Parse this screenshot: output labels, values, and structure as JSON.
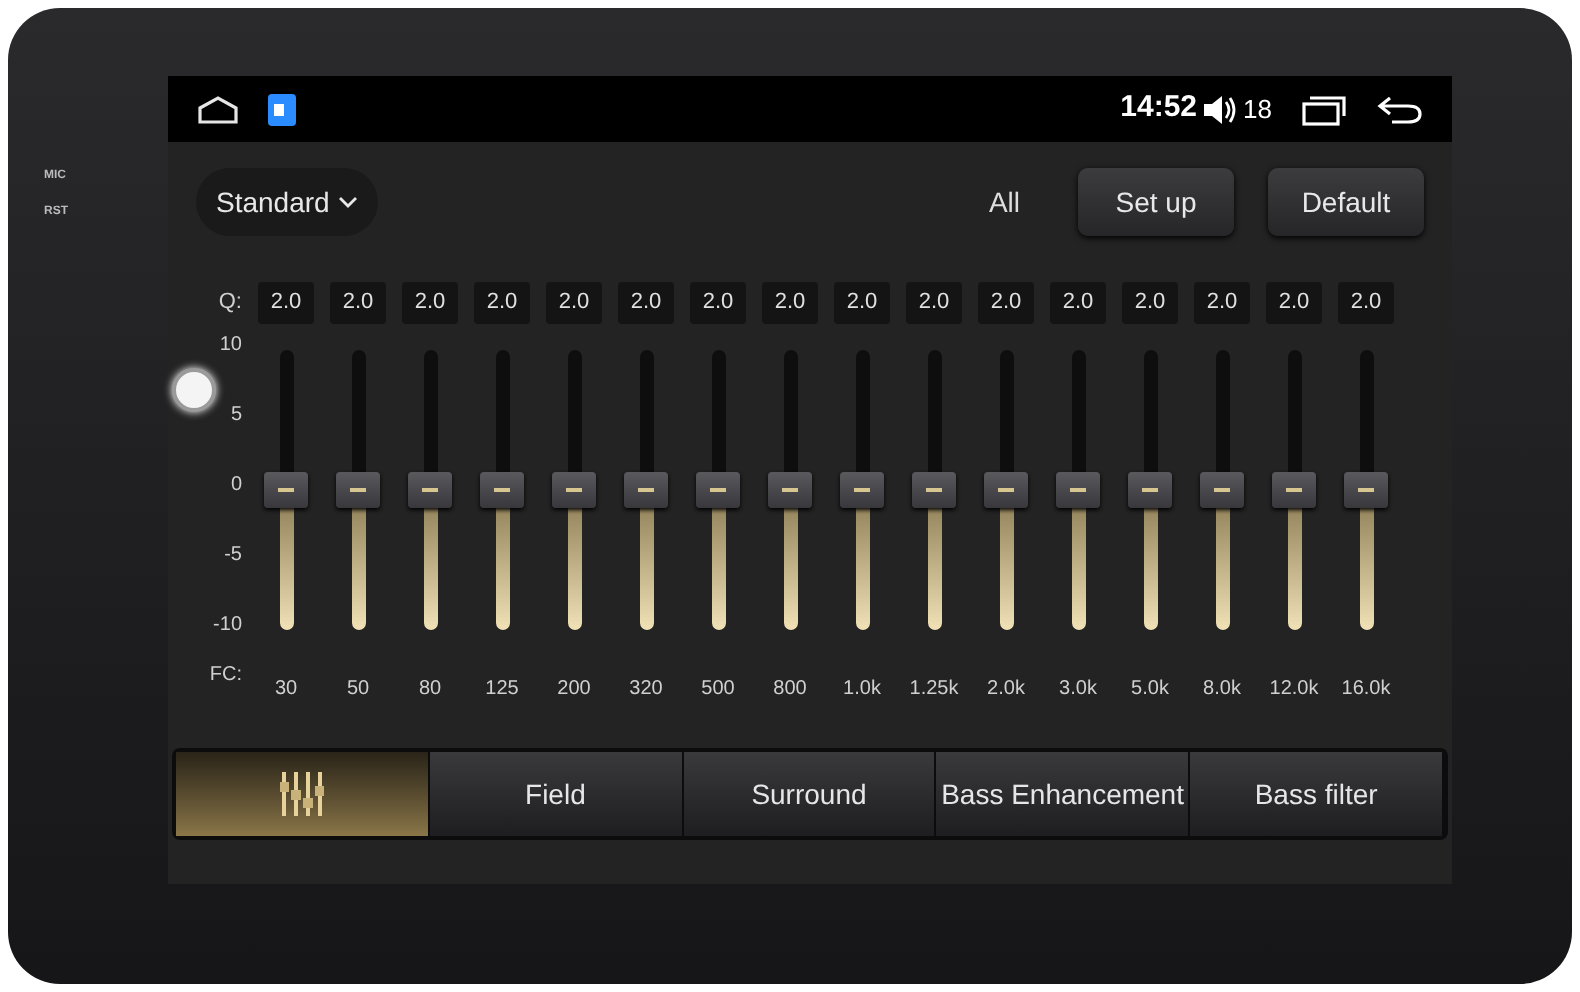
{
  "bezel": {
    "labels": [
      "MIC",
      "RST"
    ]
  },
  "status_bar": {
    "time": "14:52",
    "volume": "18"
  },
  "toolbar": {
    "preset": "Standard",
    "all_label": "All",
    "buttons": [
      "Set up",
      "Default"
    ]
  },
  "equalizer": {
    "q_label": "Q:",
    "fc_label": "FC:",
    "scale": [
      "10",
      "5",
      "0",
      "-5",
      "-10"
    ],
    "bands": [
      {
        "q": "2.0",
        "fc": "30",
        "level": 0.5
      },
      {
        "q": "2.0",
        "fc": "50",
        "level": 0.5
      },
      {
        "q": "2.0",
        "fc": "80",
        "level": 0.5
      },
      {
        "q": "2.0",
        "fc": "125",
        "level": 0.5
      },
      {
        "q": "2.0",
        "fc": "200",
        "level": 0.5
      },
      {
        "q": "2.0",
        "fc": "320",
        "level": 0.5
      },
      {
        "q": "2.0",
        "fc": "500",
        "level": 0.5
      },
      {
        "q": "2.0",
        "fc": "800",
        "level": 0.5
      },
      {
        "q": "2.0",
        "fc": "1.0k",
        "level": 0.5
      },
      {
        "q": "2.0",
        "fc": "1.25k",
        "level": 0.5
      },
      {
        "q": "2.0",
        "fc": "2.0k",
        "level": 0.5
      },
      {
        "q": "2.0",
        "fc": "3.0k",
        "level": 0.5
      },
      {
        "q": "2.0",
        "fc": "5.0k",
        "level": 0.5
      },
      {
        "q": "2.0",
        "fc": "8.0k",
        "level": 0.5
      },
      {
        "q": "2.0",
        "fc": "12.0k",
        "level": 0.5
      },
      {
        "q": "2.0",
        "fc": "16.0k",
        "level": 0.5
      }
    ]
  },
  "tabs": [
    {
      "kind": "icon",
      "selected": true
    },
    {
      "kind": "text",
      "label": "Field",
      "selected": false
    },
    {
      "kind": "text",
      "label": "Surround",
      "selected": false
    },
    {
      "kind": "text",
      "label": "Bass Enhancement",
      "selected": false
    },
    {
      "kind": "text",
      "label": "Bass filter",
      "selected": false
    }
  ]
}
